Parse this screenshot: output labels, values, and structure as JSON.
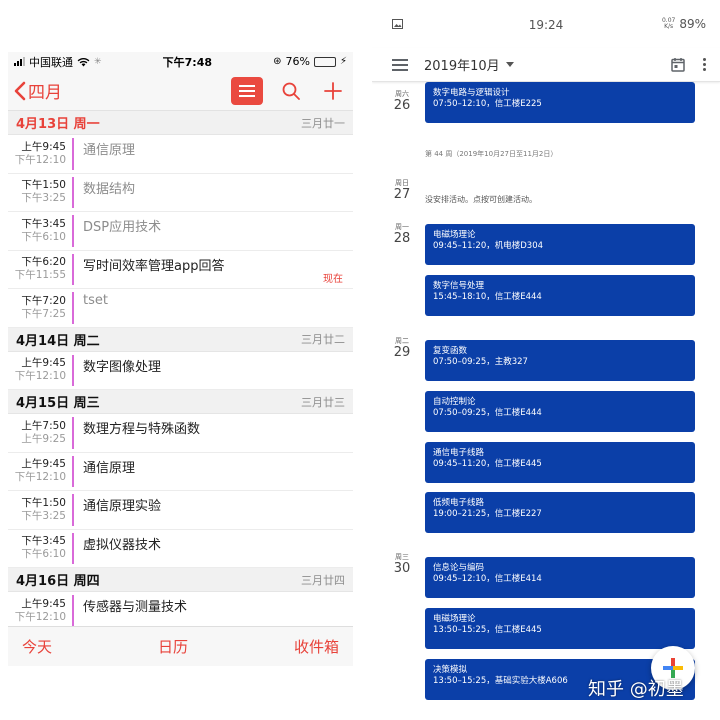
{
  "ios": {
    "status": {
      "carrier": "中国联通",
      "time": "下午7:48",
      "battery": "76%",
      "battery_level": 0.76
    },
    "nav": {
      "back_label": "四月"
    },
    "days": [
      {
        "date": "4月13日 周一",
        "lunar": "三月廿一",
        "today": true,
        "events": [
          {
            "start": "上午9:45",
            "end": "下午12:10",
            "title": "通信原理",
            "past": true
          },
          {
            "start": "下午1:50",
            "end": "下午3:25",
            "title": "数据结构",
            "past": true
          },
          {
            "start": "下午3:45",
            "end": "下午6:10",
            "title": "DSP应用技术",
            "past": true
          },
          {
            "start": "下午6:20",
            "end": "下午11:55",
            "title": "写时间效率管理app回答",
            "past": false,
            "now": "现在"
          },
          {
            "start": "下午7:20",
            "end": "下午7:25",
            "title": "tset",
            "past": true
          }
        ]
      },
      {
        "date": "4月14日 周二",
        "lunar": "三月廿二",
        "today": false,
        "events": [
          {
            "start": "上午9:45",
            "end": "下午12:10",
            "title": "数字图像处理",
            "past": false
          }
        ]
      },
      {
        "date": "4月15日 周三",
        "lunar": "三月廿三",
        "today": false,
        "events": [
          {
            "start": "上午7:50",
            "end": "上午9:25",
            "title": "数理方程与特殊函数",
            "past": false
          },
          {
            "start": "上午9:45",
            "end": "下午12:10",
            "title": "通信原理",
            "past": false
          },
          {
            "start": "下午1:50",
            "end": "下午3:25",
            "title": "通信原理实验",
            "past": false
          },
          {
            "start": "下午3:45",
            "end": "下午6:10",
            "title": "虚拟仪器技术",
            "past": false
          }
        ]
      },
      {
        "date": "4月16日 周四",
        "lunar": "三月廿四",
        "today": false,
        "events": [
          {
            "start": "上午9:45",
            "end": "下午12:10",
            "title": "传感器与测量技术",
            "past": false
          }
        ]
      }
    ],
    "tabs": {
      "today": "今天",
      "calendars": "日历",
      "inbox": "收件箱"
    },
    "accent": "#e8423a"
  },
  "android": {
    "status": {
      "time": "19:24",
      "net_speed": "0.07",
      "net_unit": "K/s",
      "battery": "89%"
    },
    "appbar": {
      "month": "2019年10月"
    },
    "week_label": "第 44 周（2019年10月27日至11月2日）",
    "no_event_text": "没安排活动。点按可创建活动。",
    "days": [
      {
        "weekday": "周六",
        "day": "26",
        "events": [
          {
            "name": "数字电路与逻辑设计",
            "info": "07:50–12:10，信工楼E225"
          }
        ]
      },
      {
        "weekday": "周日",
        "day": "27",
        "events": []
      },
      {
        "weekday": "周一",
        "day": "28",
        "events": [
          {
            "name": "电磁场理论",
            "info": "09:45–11:20，机电楼D304"
          },
          {
            "name": "数字信号处理",
            "info": "15:45–18:10，信工楼E444"
          }
        ]
      },
      {
        "weekday": "周二",
        "day": "29",
        "events": [
          {
            "name": "复变函数",
            "info": "07:50–09:25，主教327"
          },
          {
            "name": "自动控制论",
            "info": "07:50–09:25，信工楼E444"
          },
          {
            "name": "通信电子线路",
            "info": "09:45–11:20，信工楼E445"
          },
          {
            "name": "低频电子线路",
            "info": "19:00–21:25，信工楼E227"
          }
        ]
      },
      {
        "weekday": "周三",
        "day": "30",
        "events": [
          {
            "name": "信息论与编码",
            "info": "09:45–12:10，信工楼E414"
          },
          {
            "name": "电磁场理论",
            "info": "13:50–15:25，信工楼E445"
          },
          {
            "name": "决策模拟",
            "info": "13:50–15:25，基础实验大楼A606"
          }
        ]
      }
    ],
    "event_color": "#0b3fa8"
  },
  "watermark": "知乎 @初墨"
}
